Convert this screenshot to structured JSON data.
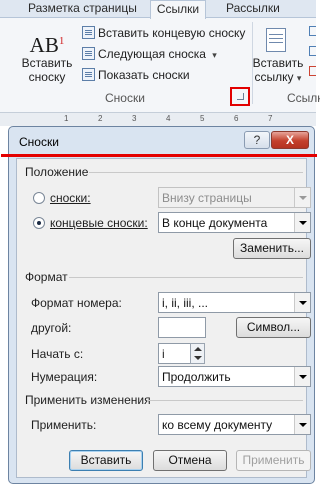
{
  "ribbon": {
    "tabs": [
      "Разметка страницы",
      "Ссылки",
      "Рассылки"
    ],
    "active_tab": "Ссылки",
    "insert_footnote": {
      "label_line1": "Вставить",
      "label_line2": "сноску"
    },
    "small_buttons": [
      "Вставить концевую сноску",
      "Следующая сноска",
      "Показать сноски"
    ],
    "group_label": "Сноски",
    "insert_citation": {
      "label_line1": "Вставить",
      "label_line2": "ссылку"
    },
    "right_group_label": "Ссылк",
    "ruler_numbers": [
      "1",
      "2",
      "3",
      "4",
      "5",
      "6",
      "7"
    ]
  },
  "dialog": {
    "title": "Сноски",
    "help": "?",
    "close": "X",
    "position_section": "Положение",
    "footnotes_label": "сноски:",
    "footnotes_value": "Внизу страницы",
    "endnotes_label": "концевые сноски:",
    "endnotes_value": "В конце документа",
    "replace_button": "Заменить...",
    "format_section": "Формат",
    "number_format_label": "Формат номера:",
    "number_format_value": "i, ii, iii, ...",
    "custom_label": "другой:",
    "custom_value": "",
    "symbol_button": "Символ...",
    "start_at_label": "Начать с:",
    "start_at_value": "i",
    "numbering_label": "Нумерация:",
    "numbering_value": "Продолжить",
    "apply_section": "Применить изменения",
    "apply_to_label": "Применить:",
    "apply_to_value": "ко всему документу",
    "insert_button": "Вставить",
    "cancel_button": "Отмена",
    "apply_button": "Применить"
  }
}
